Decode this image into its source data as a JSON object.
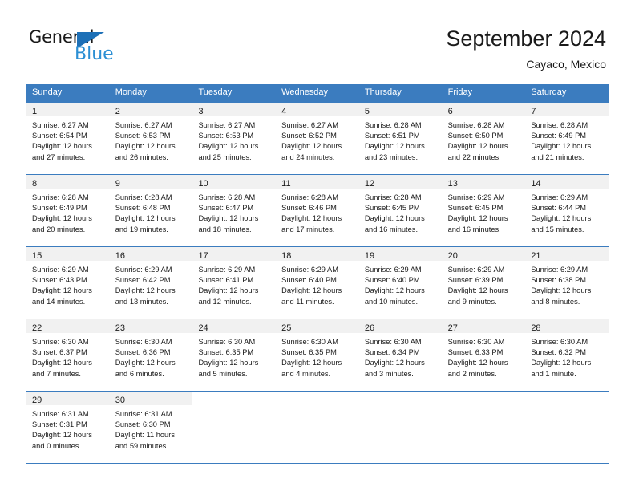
{
  "brand": {
    "name_part1": "General",
    "name_part2": "Blue",
    "triangle_icon": "blue-triangle-icon",
    "accent_color": "#2b8fd4"
  },
  "header": {
    "title": "September 2024",
    "subtitle": "Cayaco, Mexico"
  },
  "colors": {
    "header_blue": "#3b7cbf",
    "daynum_band": "#f1f1f1",
    "text": "#1a1a1a"
  },
  "calendar": {
    "day_headers": [
      "Sunday",
      "Monday",
      "Tuesday",
      "Wednesday",
      "Thursday",
      "Friday",
      "Saturday"
    ],
    "weeks": [
      [
        {
          "day": "1",
          "sunrise": "Sunrise: 6:27 AM",
          "sunset": "Sunset: 6:54 PM",
          "daylight1": "Daylight: 12 hours",
          "daylight2": "and 27 minutes."
        },
        {
          "day": "2",
          "sunrise": "Sunrise: 6:27 AM",
          "sunset": "Sunset: 6:53 PM",
          "daylight1": "Daylight: 12 hours",
          "daylight2": "and 26 minutes."
        },
        {
          "day": "3",
          "sunrise": "Sunrise: 6:27 AM",
          "sunset": "Sunset: 6:53 PM",
          "daylight1": "Daylight: 12 hours",
          "daylight2": "and 25 minutes."
        },
        {
          "day": "4",
          "sunrise": "Sunrise: 6:27 AM",
          "sunset": "Sunset: 6:52 PM",
          "daylight1": "Daylight: 12 hours",
          "daylight2": "and 24 minutes."
        },
        {
          "day": "5",
          "sunrise": "Sunrise: 6:28 AM",
          "sunset": "Sunset: 6:51 PM",
          "daylight1": "Daylight: 12 hours",
          "daylight2": "and 23 minutes."
        },
        {
          "day": "6",
          "sunrise": "Sunrise: 6:28 AM",
          "sunset": "Sunset: 6:50 PM",
          "daylight1": "Daylight: 12 hours",
          "daylight2": "and 22 minutes."
        },
        {
          "day": "7",
          "sunrise": "Sunrise: 6:28 AM",
          "sunset": "Sunset: 6:49 PM",
          "daylight1": "Daylight: 12 hours",
          "daylight2": "and 21 minutes."
        }
      ],
      [
        {
          "day": "8",
          "sunrise": "Sunrise: 6:28 AM",
          "sunset": "Sunset: 6:49 PM",
          "daylight1": "Daylight: 12 hours",
          "daylight2": "and 20 minutes."
        },
        {
          "day": "9",
          "sunrise": "Sunrise: 6:28 AM",
          "sunset": "Sunset: 6:48 PM",
          "daylight1": "Daylight: 12 hours",
          "daylight2": "and 19 minutes."
        },
        {
          "day": "10",
          "sunrise": "Sunrise: 6:28 AM",
          "sunset": "Sunset: 6:47 PM",
          "daylight1": "Daylight: 12 hours",
          "daylight2": "and 18 minutes."
        },
        {
          "day": "11",
          "sunrise": "Sunrise: 6:28 AM",
          "sunset": "Sunset: 6:46 PM",
          "daylight1": "Daylight: 12 hours",
          "daylight2": "and 17 minutes."
        },
        {
          "day": "12",
          "sunrise": "Sunrise: 6:28 AM",
          "sunset": "Sunset: 6:45 PM",
          "daylight1": "Daylight: 12 hours",
          "daylight2": "and 16 minutes."
        },
        {
          "day": "13",
          "sunrise": "Sunrise: 6:29 AM",
          "sunset": "Sunset: 6:45 PM",
          "daylight1": "Daylight: 12 hours",
          "daylight2": "and 16 minutes."
        },
        {
          "day": "14",
          "sunrise": "Sunrise: 6:29 AM",
          "sunset": "Sunset: 6:44 PM",
          "daylight1": "Daylight: 12 hours",
          "daylight2": "and 15 minutes."
        }
      ],
      [
        {
          "day": "15",
          "sunrise": "Sunrise: 6:29 AM",
          "sunset": "Sunset: 6:43 PM",
          "daylight1": "Daylight: 12 hours",
          "daylight2": "and 14 minutes."
        },
        {
          "day": "16",
          "sunrise": "Sunrise: 6:29 AM",
          "sunset": "Sunset: 6:42 PM",
          "daylight1": "Daylight: 12 hours",
          "daylight2": "and 13 minutes."
        },
        {
          "day": "17",
          "sunrise": "Sunrise: 6:29 AM",
          "sunset": "Sunset: 6:41 PM",
          "daylight1": "Daylight: 12 hours",
          "daylight2": "and 12 minutes."
        },
        {
          "day": "18",
          "sunrise": "Sunrise: 6:29 AM",
          "sunset": "Sunset: 6:40 PM",
          "daylight1": "Daylight: 12 hours",
          "daylight2": "and 11 minutes."
        },
        {
          "day": "19",
          "sunrise": "Sunrise: 6:29 AM",
          "sunset": "Sunset: 6:40 PM",
          "daylight1": "Daylight: 12 hours",
          "daylight2": "and 10 minutes."
        },
        {
          "day": "20",
          "sunrise": "Sunrise: 6:29 AM",
          "sunset": "Sunset: 6:39 PM",
          "daylight1": "Daylight: 12 hours",
          "daylight2": "and 9 minutes."
        },
        {
          "day": "21",
          "sunrise": "Sunrise: 6:29 AM",
          "sunset": "Sunset: 6:38 PM",
          "daylight1": "Daylight: 12 hours",
          "daylight2": "and 8 minutes."
        }
      ],
      [
        {
          "day": "22",
          "sunrise": "Sunrise: 6:30 AM",
          "sunset": "Sunset: 6:37 PM",
          "daylight1": "Daylight: 12 hours",
          "daylight2": "and 7 minutes."
        },
        {
          "day": "23",
          "sunrise": "Sunrise: 6:30 AM",
          "sunset": "Sunset: 6:36 PM",
          "daylight1": "Daylight: 12 hours",
          "daylight2": "and 6 minutes."
        },
        {
          "day": "24",
          "sunrise": "Sunrise: 6:30 AM",
          "sunset": "Sunset: 6:35 PM",
          "daylight1": "Daylight: 12 hours",
          "daylight2": "and 5 minutes."
        },
        {
          "day": "25",
          "sunrise": "Sunrise: 6:30 AM",
          "sunset": "Sunset: 6:35 PM",
          "daylight1": "Daylight: 12 hours",
          "daylight2": "and 4 minutes."
        },
        {
          "day": "26",
          "sunrise": "Sunrise: 6:30 AM",
          "sunset": "Sunset: 6:34 PM",
          "daylight1": "Daylight: 12 hours",
          "daylight2": "and 3 minutes."
        },
        {
          "day": "27",
          "sunrise": "Sunrise: 6:30 AM",
          "sunset": "Sunset: 6:33 PM",
          "daylight1": "Daylight: 12 hours",
          "daylight2": "and 2 minutes."
        },
        {
          "day": "28",
          "sunrise": "Sunrise: 6:30 AM",
          "sunset": "Sunset: 6:32 PM",
          "daylight1": "Daylight: 12 hours",
          "daylight2": "and 1 minute."
        }
      ],
      [
        {
          "day": "29",
          "sunrise": "Sunrise: 6:31 AM",
          "sunset": "Sunset: 6:31 PM",
          "daylight1": "Daylight: 12 hours",
          "daylight2": "and 0 minutes."
        },
        {
          "day": "30",
          "sunrise": "Sunrise: 6:31 AM",
          "sunset": "Sunset: 6:30 PM",
          "daylight1": "Daylight: 11 hours",
          "daylight2": "and 59 minutes."
        },
        {
          "day": "",
          "sunrise": "",
          "sunset": "",
          "daylight1": "",
          "daylight2": ""
        },
        {
          "day": "",
          "sunrise": "",
          "sunset": "",
          "daylight1": "",
          "daylight2": ""
        },
        {
          "day": "",
          "sunrise": "",
          "sunset": "",
          "daylight1": "",
          "daylight2": ""
        },
        {
          "day": "",
          "sunrise": "",
          "sunset": "",
          "daylight1": "",
          "daylight2": ""
        },
        {
          "day": "",
          "sunrise": "",
          "sunset": "",
          "daylight1": "",
          "daylight2": ""
        }
      ]
    ]
  }
}
